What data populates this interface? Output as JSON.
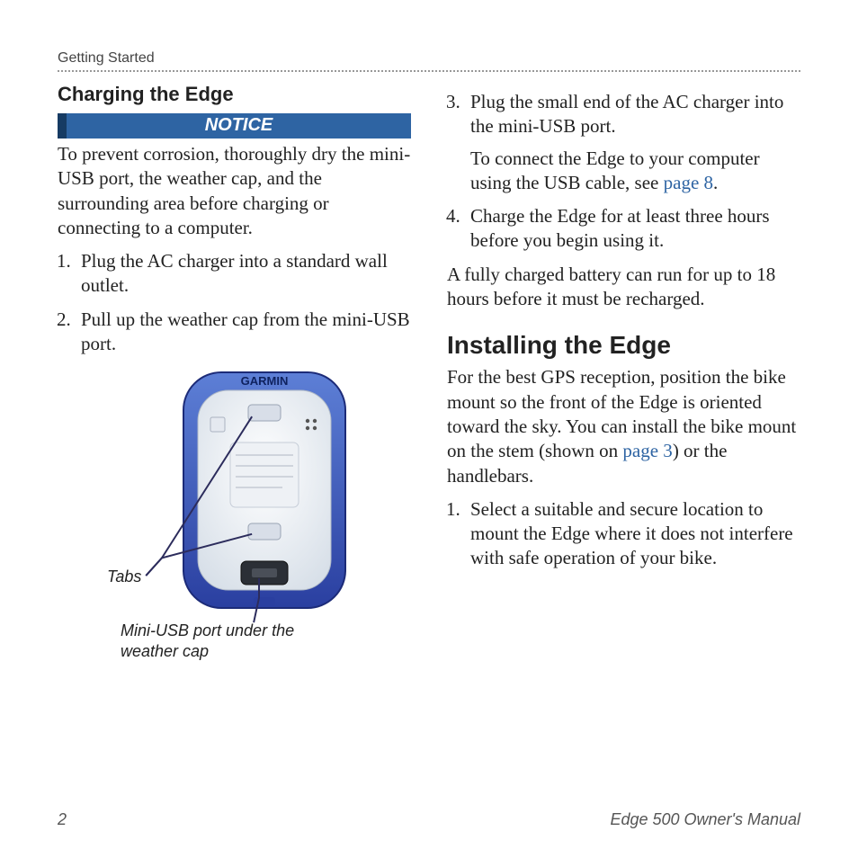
{
  "run_head": "Getting Started",
  "left": {
    "section_title": "Charging the Edge",
    "notice_label": "NOTICE",
    "notice_body": "To prevent corrosion, thoroughly dry the mini-USB port, the weather cap, and the surrounding area before charging or connecting to a computer.",
    "step1": "Plug the AC charger into a standard wall outlet.",
    "step2": "Pull up the weather cap from the mini-USB port.",
    "fig_tabs": "Tabs",
    "fig_port": "Mini-USB port under the weather cap",
    "device_brand": "GARMIN"
  },
  "right": {
    "step3": "Plug the small end of the AC charger into the mini-USB port.",
    "step3_note_pre": "To connect the Edge to your computer using the USB cable, see ",
    "step3_link": "page 8",
    "step3_note_post": ".",
    "step4": "Charge the Edge for at least three hours before you begin using it.",
    "after_list": "A fully charged battery can run for up to 18 hours before it must be recharged.",
    "heading": "Installing the Edge",
    "intro_pre": "For the best GPS reception, position the bike mount so the front of the Edge is oriented toward the sky. You can install the bike mount on the stem (shown on ",
    "intro_link": "page 3",
    "intro_post": ") or the handlebars.",
    "install_step1": "Select a suitable and secure location to mount the Edge where it does not interfere with safe operation of your bike."
  },
  "footer": {
    "page": "2",
    "manual": "Edge 500 Owner's Manual"
  }
}
